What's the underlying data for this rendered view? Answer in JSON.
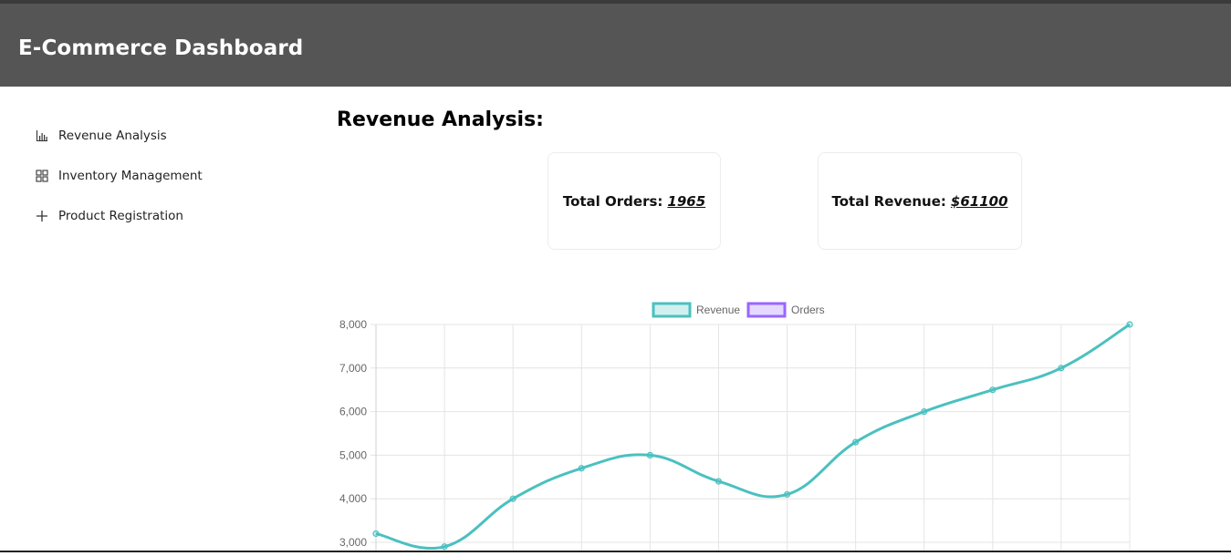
{
  "header": {
    "title": "E-Commerce Dashboard"
  },
  "sidebar": {
    "items": [
      {
        "label": "Revenue Analysis",
        "icon": "bar-chart-icon"
      },
      {
        "label": "Inventory Management",
        "icon": "grid-icon"
      },
      {
        "label": "Product Registration",
        "icon": "plus-icon"
      }
    ]
  },
  "main": {
    "title": "Revenue Analysis:",
    "cards": {
      "orders": {
        "label": "Total Orders:",
        "value": "1965"
      },
      "revenue": {
        "label": "Total Revenue:",
        "value": "$61100"
      }
    }
  },
  "chart_data": {
    "type": "line",
    "title": "",
    "xlabel": "",
    "ylabel": "",
    "ylim": [
      3000,
      8000
    ],
    "yticks": [
      "8,000",
      "7,000",
      "6,000",
      "5,000",
      "4,000",
      "3,000"
    ],
    "x": [
      0,
      1,
      2,
      3,
      4,
      5,
      6,
      7,
      8,
      9,
      10,
      11
    ],
    "grid": true,
    "legend_position": "top",
    "series": [
      {
        "name": "Revenue",
        "color": "#4bc0c0",
        "values": [
          3200,
          2900,
          4000,
          4700,
          5000,
          4400,
          4100,
          5300,
          6000,
          6500,
          7000,
          8000
        ]
      },
      {
        "name": "Orders",
        "color": "#9966ff",
        "values": []
      }
    ]
  },
  "colors": {
    "header_bg": "#555555",
    "revenue": "#4bc0c0",
    "orders": "#9966ff"
  }
}
